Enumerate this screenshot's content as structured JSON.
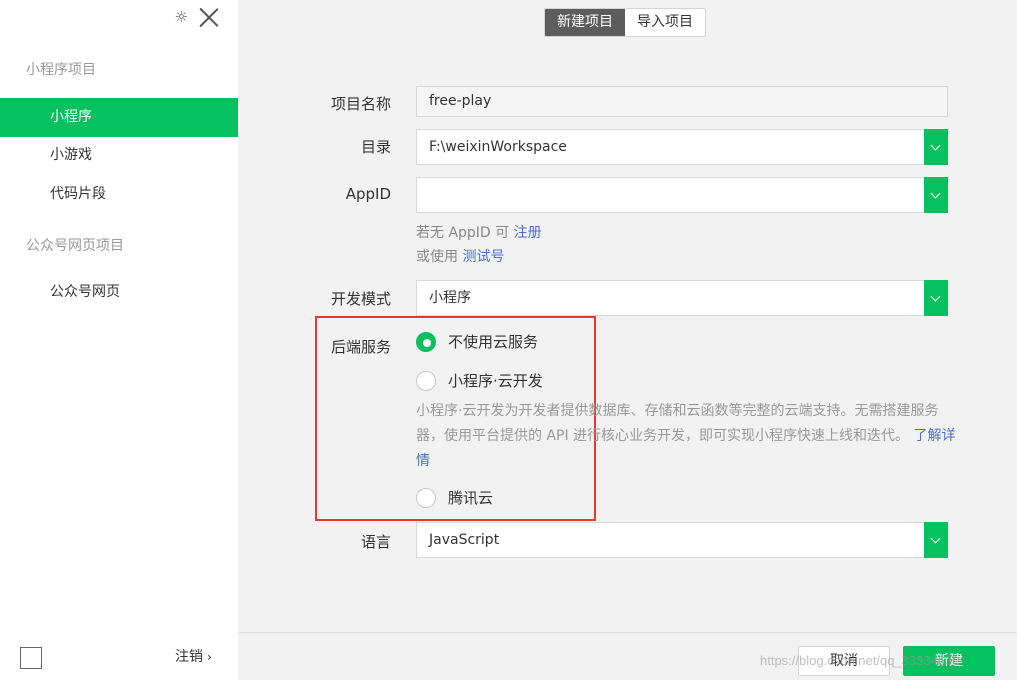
{
  "sidebar": {
    "section_miniprogram": "小程序项目",
    "items_mini": [
      {
        "label": "小程序"
      },
      {
        "label": "小游戏"
      },
      {
        "label": "代码片段"
      }
    ],
    "section_official": "公众号网页项目",
    "items_official": [
      {
        "label": "公众号网页"
      }
    ],
    "logout_label": "注销",
    "settings_icon": "gear-icon",
    "close_icon": "close-icon"
  },
  "tabs": [
    {
      "label": "新建项目",
      "active": true
    },
    {
      "label": "导入项目",
      "active": false
    }
  ],
  "form": {
    "project_name": {
      "label": "项目名称",
      "value": "free-play"
    },
    "directory": {
      "label": "目录",
      "value": "F:\\weixinWorkspace"
    },
    "appid": {
      "label": "AppID",
      "value": ""
    },
    "appid_hint": {
      "prefix": "若无 AppID 可 ",
      "link": "注册"
    },
    "test_hint": {
      "prefix": "或使用 ",
      "link": "测试号"
    },
    "dev_mode": {
      "label": "开发模式",
      "value": "小程序"
    },
    "backend": {
      "label": "后端服务",
      "options": [
        {
          "label": "不使用云服务",
          "checked": true
        },
        {
          "label": "小程序·云开发",
          "checked": false
        },
        {
          "label": "腾讯云",
          "checked": false
        }
      ],
      "description": "小程序·云开发为开发者提供数据库、存储和云函数等完整的云端支持。无需搭建服务器，使用平台提供的 API 进行核心业务开发，即可实现小程序快速上线和迭代。",
      "description_link": "了解详情"
    },
    "language": {
      "label": "语言",
      "value": "JavaScript"
    }
  },
  "footer": {
    "cancel_label": "取消",
    "create_label": "新建",
    "watermark": "https://blog.csdn.net/qq_33334639"
  },
  "colors": {
    "accent": "#07c160",
    "highlight_box": "#e53935",
    "link": "#4a6fd0"
  }
}
